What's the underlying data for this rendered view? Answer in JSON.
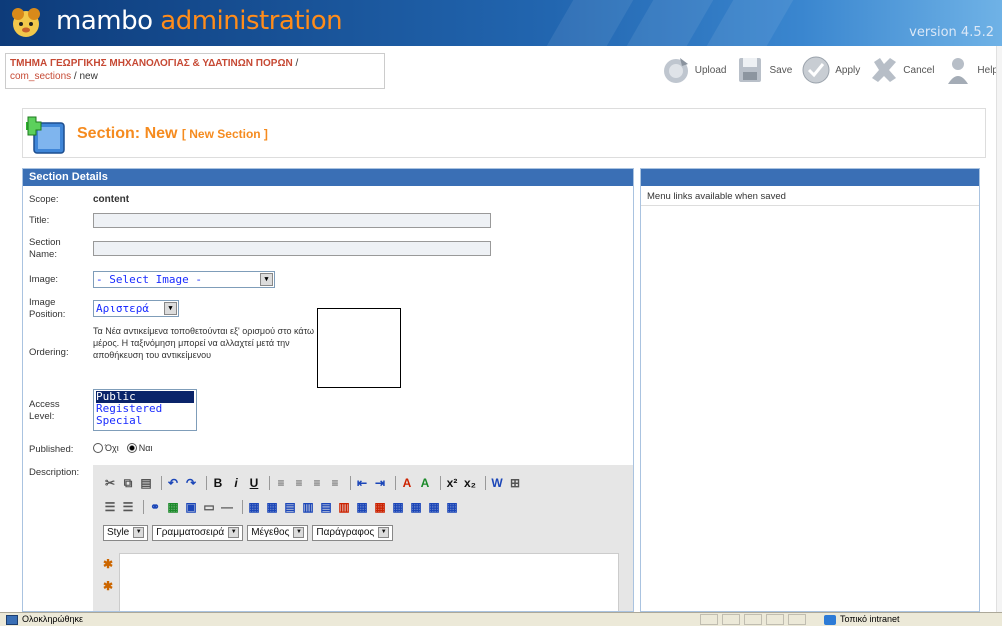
{
  "header": {
    "logo_main": "mambo",
    "logo_accent": "administration",
    "version": "version 4.5.2",
    "brand_orange": "#ff8c1a"
  },
  "pathway": {
    "segment_1": "ΤΜΗΜΑ ΓΕΩΡΓΙΚΗΣ ΜΗΧΑΝΟΛΟΓΙΑΣ & ΥΔΑΤΙΝΩΝ ΠΟΡΩΝ",
    "sep_1": " /",
    "segment_2": "com_sections",
    "sep_2": " / ",
    "segment_3": "new"
  },
  "toolbar": {
    "upload": "Upload",
    "save": "Save",
    "apply": "Apply",
    "cancel": "Cancel",
    "help": "Help"
  },
  "page": {
    "title": "Section: New",
    "subtitle": "[ New Section ]"
  },
  "details": {
    "heading": "Section Details",
    "scope_label": "Scope:",
    "scope_value": "content",
    "title_label": "Title:",
    "title_value": "",
    "name_label_1": "Section",
    "name_label_2": "Name:",
    "name_value": "",
    "image_label": "Image:",
    "image_selected": "- Select Image -",
    "image_position_label_1": "Image",
    "image_position_label_2": "Position:",
    "image_position_selected": "Αριστερά",
    "ordering_label": "Ordering:",
    "ordering_text": "Τα Νέα αντικείμενα τοποθετούνται εξ' ορισμού στο κάτω μέρος. Η ταξινόμηση μπορεί να αλλαχτεί μετά την αποθήκευση του αντικείμενου",
    "access_label_1": "Access",
    "access_label_2": "Level:",
    "access_options": [
      "Public",
      "Registered",
      "Special"
    ],
    "published_label": "Published:",
    "published_no": "Όχι",
    "published_yes": "Ναι",
    "description_label": "Description:"
  },
  "editor": {
    "style_drop": "Style",
    "font_drop": "Γραμματοσειρά",
    "size_drop": "Μέγεθος",
    "format_drop": "Παράγραφος"
  },
  "right_panel": {
    "info": "Menu links available when saved"
  },
  "statusbar": {
    "text": "Ολοκληρώθηκε",
    "zone": "Τοπικό intranet"
  }
}
